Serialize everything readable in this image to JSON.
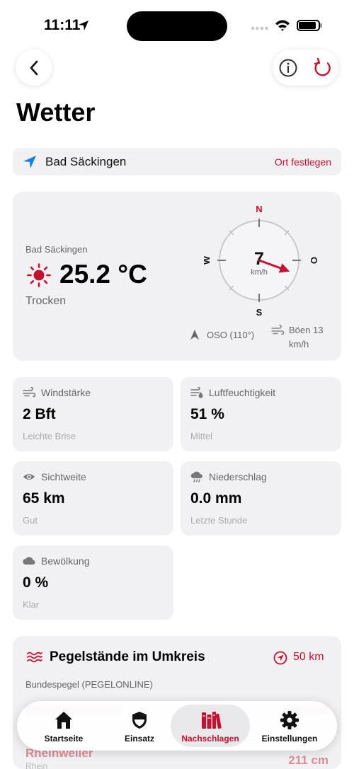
{
  "status": {
    "time": "11:11"
  },
  "page": {
    "title": "Wetter"
  },
  "location": {
    "name": "Bad Säckingen",
    "action": "Ort festlegen"
  },
  "weather": {
    "place": "Bad Säckingen",
    "temperature": "25.2 °C",
    "condition": "Trocken",
    "compass": {
      "n": "N",
      "o": "O",
      "s": "S",
      "w": "W",
      "speed": "7",
      "unit": "km/h",
      "direction_deg": 110
    },
    "direction": "OSO (110°)",
    "gusts": "Böen 13 km/h"
  },
  "metrics": [
    {
      "icon": "wind-icon",
      "label": "Windstärke",
      "value": "2 Bft",
      "sub": "Leichte Brise"
    },
    {
      "icon": "humidity-icon",
      "label": "Luftfeuchtigkeit",
      "value": "51 %",
      "sub": "Mittel"
    },
    {
      "icon": "eye-icon",
      "label": "Sichtweite",
      "value": "65 km",
      "sub": "Gut"
    },
    {
      "icon": "rain-cloud-icon",
      "label": "Niederschlag",
      "value": "0.0 mm",
      "sub": "Letzte Stunde"
    },
    {
      "icon": "cloud-icon",
      "label": "Bewölkung",
      "value": "0 %",
      "sub": "Klar"
    }
  ],
  "gauges": {
    "title": "Pegelstände im Umkreis",
    "radius": "50 km",
    "subtitle": "Bundespegel (PEGELONLINE)",
    "first_station": "Rheinweiler",
    "first_river": "Rhein",
    "first_level": "211 cm"
  },
  "tabs": [
    {
      "label": "Startseite",
      "icon": "home-icon",
      "active": false
    },
    {
      "label": "Einsatz",
      "icon": "shield-icon",
      "active": false
    },
    {
      "label": "Nachschlagen",
      "icon": "books-icon",
      "active": true
    },
    {
      "label": "Einstellungen",
      "icon": "gear-icon",
      "active": false
    }
  ],
  "colors": {
    "accent": "#c8102e",
    "location_icon": "#1a7cf0",
    "card": "#f1f1f3"
  }
}
